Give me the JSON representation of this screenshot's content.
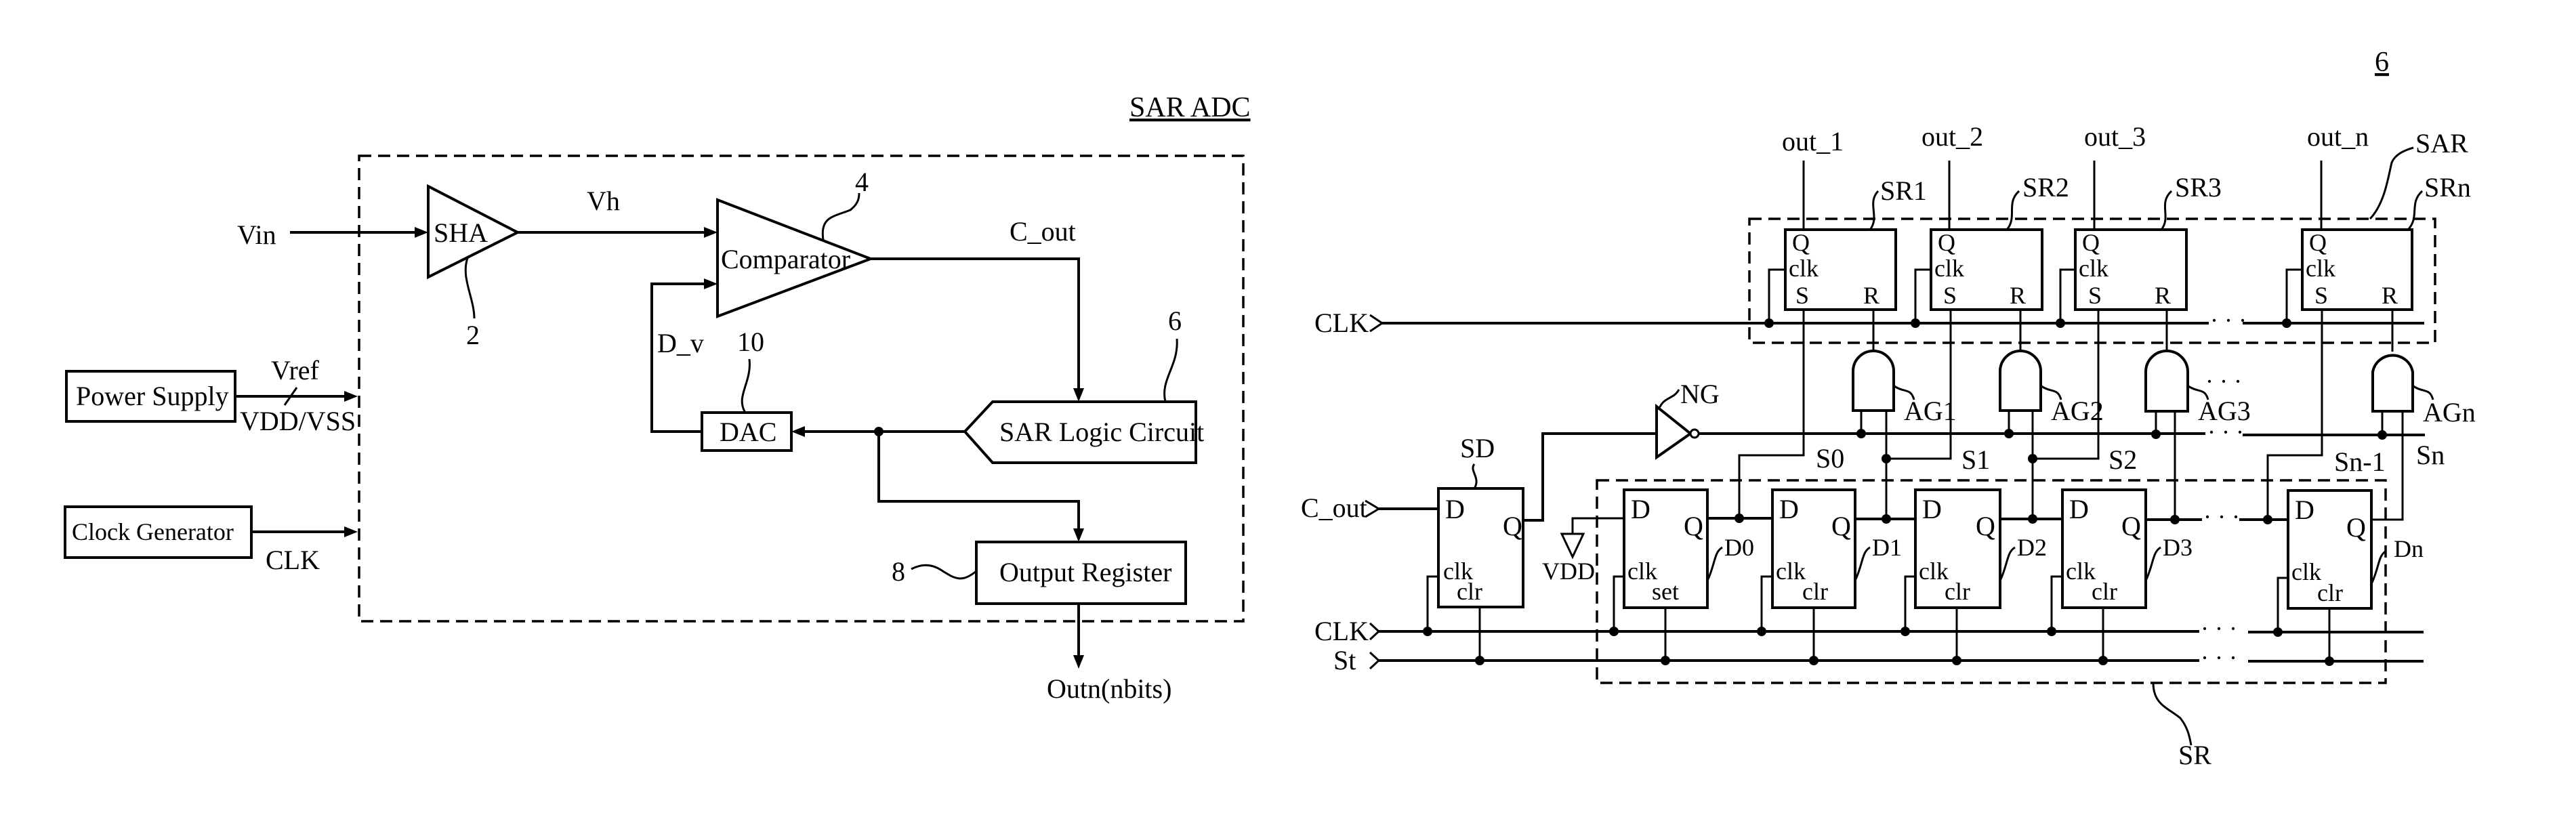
{
  "left_panel": {
    "title": "SAR ADC",
    "inputs": {
      "vin": "Vin",
      "vref": "Vref",
      "vdd_vss": "VDD/VSS",
      "clk": "CLK"
    },
    "blocks": {
      "power_supply": "Power Supply",
      "clock_generator": "Clock Generator",
      "sha": "SHA",
      "comparator": "Comparator",
      "dac": "DAC",
      "sar_logic": "SAR Logic Circuit",
      "output_register": "Output Register"
    },
    "signals": {
      "vh": "Vh",
      "c_out": "C_out",
      "d_v": "D_v",
      "outn": "Outn(nbits)"
    },
    "ref_numerals": {
      "sha": "2",
      "comparator": "4",
      "sar_logic": "6",
      "output_register": "8",
      "dac": "10"
    }
  },
  "right_panel": {
    "figure_ref": "6",
    "group_labels": {
      "sar": "SAR",
      "sr": "SR",
      "sd": "SD",
      "ng": "NG"
    },
    "inputs": {
      "clk_top": "CLK",
      "c_out": "C_out",
      "clk_bottom": "CLK",
      "st": "St",
      "vdd": "VDD"
    },
    "sr_latches": [
      {
        "name": "SR1",
        "out": "out_1"
      },
      {
        "name": "SR2",
        "out": "out_2"
      },
      {
        "name": "SR3",
        "out": "out_3"
      },
      {
        "name": "SRn",
        "out": "out_n"
      }
    ],
    "sr_pins": {
      "q": "Q",
      "clk": "clk",
      "s": "S",
      "r": "R"
    },
    "and_gates": [
      "AG1",
      "AG2",
      "AG3",
      "AGn"
    ],
    "and_ellipsis": "· · ·",
    "set_lines": [
      "S0",
      "S1",
      "S2",
      "Sn-1",
      "Sn"
    ],
    "d_flipflops": [
      {
        "name": "D0",
        "ctrl": "set"
      },
      {
        "name": "D1",
        "ctrl": "clr"
      },
      {
        "name": "D2",
        "ctrl": "clr"
      },
      {
        "name": "D3",
        "ctrl": "clr"
      },
      {
        "name": "Dn",
        "ctrl": "clr"
      }
    ],
    "sd_ctrl": "clr",
    "dff_pins": {
      "d": "D",
      "q": "Q",
      "clk": "clk"
    },
    "break_symbol": "· · ·"
  }
}
